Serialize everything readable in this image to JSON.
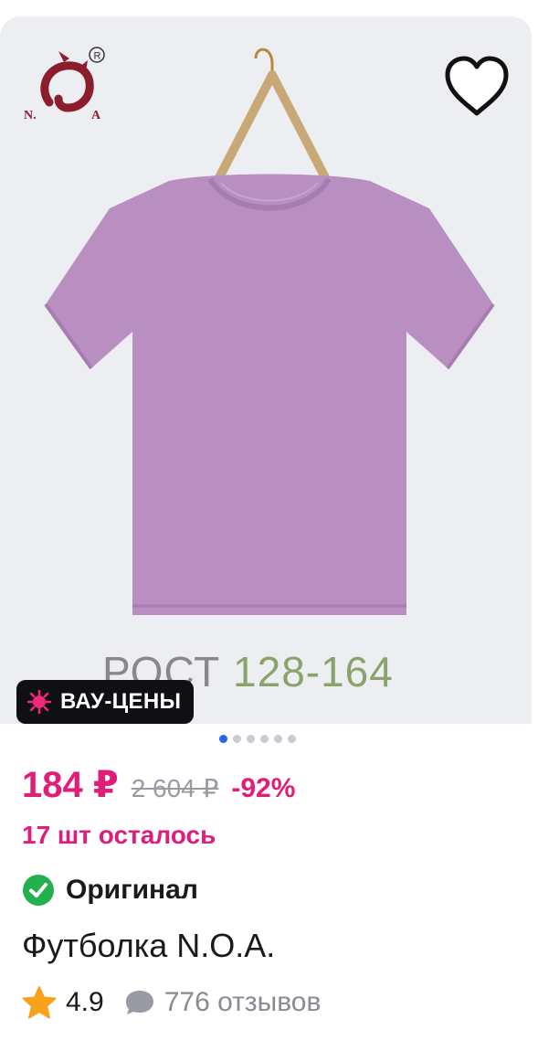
{
  "image": {
    "size_text_word": "РОСТ",
    "size_text_range": "128-164",
    "brand_logo_text": "N.O.A",
    "carousel_dots": 6,
    "carousel_active_index": 0
  },
  "badge": {
    "label": "ВАУ-ЦЕНЫ"
  },
  "price": {
    "current": "184 ₽",
    "old": "2 604 ₽",
    "discount": "-92%"
  },
  "stock": {
    "text": "17 шт осталось"
  },
  "original": {
    "label": "Оригинал"
  },
  "product": {
    "name": "Футболка N.O.A."
  },
  "rating": {
    "value": "4.9",
    "reviews": "776 отзывов"
  },
  "colors": {
    "accent": "#e01e79",
    "check_green": "#22b14c",
    "star_orange": "#f7a21b",
    "tshirt": "#b98fc2",
    "active_dot": "#2a62e8",
    "badge_bg": "#0f0f14"
  }
}
